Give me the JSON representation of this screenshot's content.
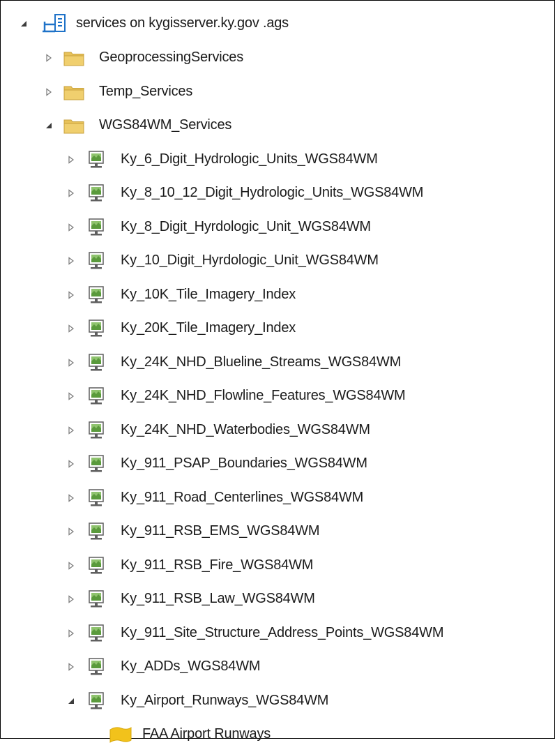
{
  "tree": {
    "root": {
      "label": "services on kygisserver.ky.gov .ags",
      "icon": "ags-server-connection-icon",
      "expanded": true
    },
    "folders": [
      {
        "label": "GeoprocessingServices",
        "icon": "folder-icon",
        "expanded": false
      },
      {
        "label": "Temp_Services",
        "icon": "folder-icon",
        "expanded": false
      },
      {
        "label": "WGS84WM_Services",
        "icon": "folder-icon",
        "expanded": true
      }
    ],
    "services": [
      {
        "label": "Ky_6_Digit_Hydrologic_Units_WGS84WM",
        "icon": "map-service-icon",
        "expanded": false
      },
      {
        "label": "Ky_8_10_12_Digit_Hydrologic_Units_WGS84WM",
        "icon": "map-service-icon",
        "expanded": false
      },
      {
        "label": "Ky_8_Digit_Hyrdologic_Unit_WGS84WM",
        "icon": "map-service-icon",
        "expanded": false
      },
      {
        "label": "Ky_10_Digit_Hyrdologic_Unit_WGS84WM",
        "icon": "map-service-icon",
        "expanded": false
      },
      {
        "label": "Ky_10K_Tile_Imagery_Index",
        "icon": "map-service-icon",
        "expanded": false
      },
      {
        "label": "Ky_20K_Tile_Imagery_Index",
        "icon": "map-service-icon",
        "expanded": false
      },
      {
        "label": "Ky_24K_NHD_Blueline_Streams_WGS84WM",
        "icon": "map-service-icon",
        "expanded": false
      },
      {
        "label": "Ky_24K_NHD_Flowline_Features_WGS84WM",
        "icon": "map-service-icon",
        "expanded": false
      },
      {
        "label": "Ky_24K_NHD_Waterbodies_WGS84WM",
        "icon": "map-service-icon",
        "expanded": false
      },
      {
        "label": "Ky_911_PSAP_Boundaries_WGS84WM",
        "icon": "map-service-icon",
        "expanded": false
      },
      {
        "label": "Ky_911_Road_Centerlines_WGS84WM",
        "icon": "map-service-icon",
        "expanded": false
      },
      {
        "label": "Ky_911_RSB_EMS_WGS84WM",
        "icon": "map-service-icon",
        "expanded": false
      },
      {
        "label": "Ky_911_RSB_Fire_WGS84WM",
        "icon": "map-service-icon",
        "expanded": false
      },
      {
        "label": "Ky_911_RSB_Law_WGS84WM",
        "icon": "map-service-icon",
        "expanded": false
      },
      {
        "label": "Ky_911_Site_Structure_Address_Points_WGS84WM",
        "icon": "map-service-icon",
        "expanded": false
      },
      {
        "label": "Ky_ADDs_WGS84WM",
        "icon": "map-service-icon",
        "expanded": false
      },
      {
        "label": "Ky_Airport_Runways_WGS84WM",
        "icon": "map-service-icon",
        "expanded": true
      }
    ],
    "layers": [
      {
        "label": "FAA Airport Runways",
        "icon": "polygon-layer-icon"
      }
    ]
  },
  "colors": {
    "folder": "#e8c25a",
    "server_blue": "#1e72c8",
    "service_green": "#5a9a3c",
    "layer_yellow": "#f2c21b",
    "expander": "#7a7a7a"
  }
}
